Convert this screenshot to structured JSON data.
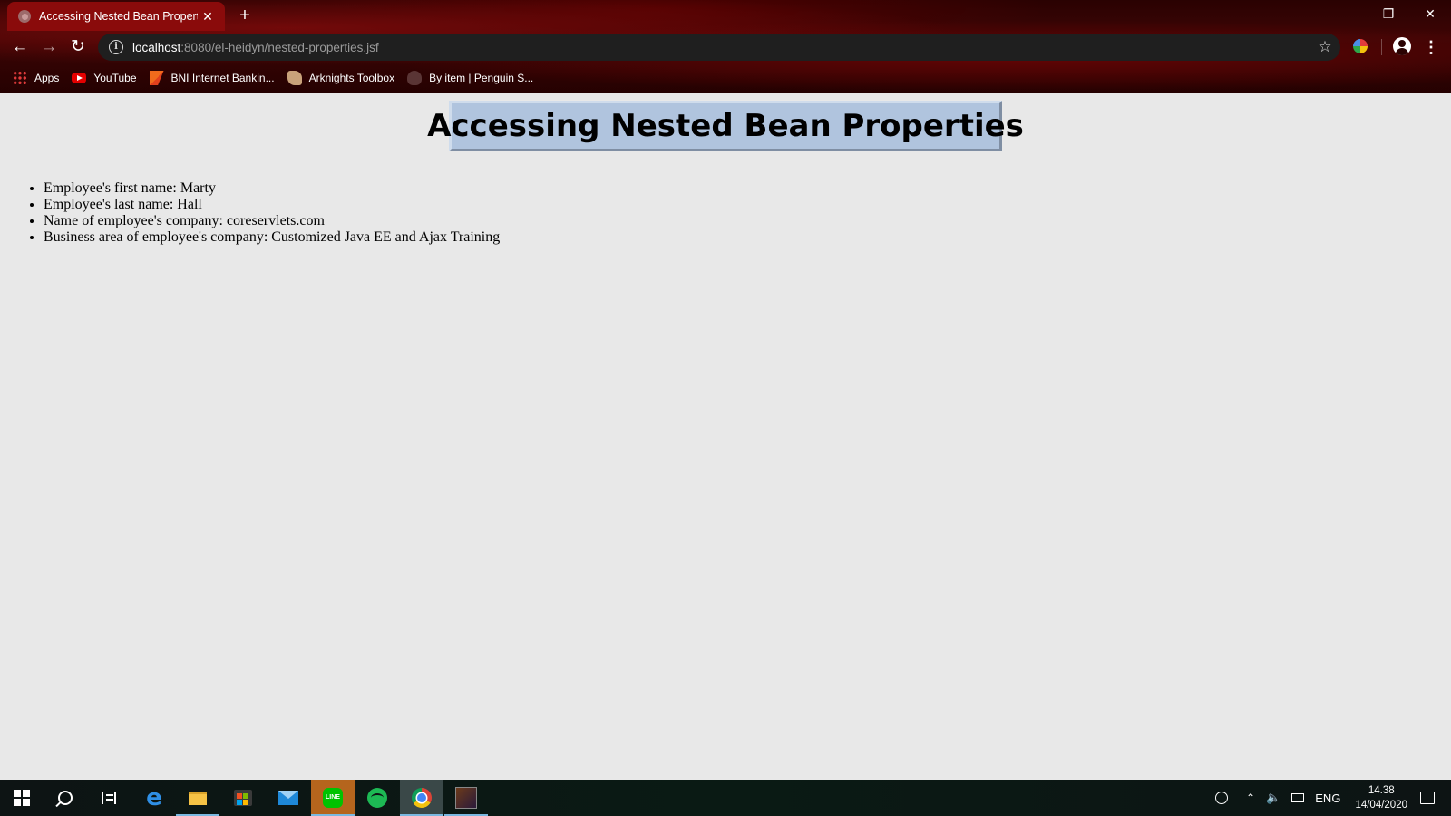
{
  "browser": {
    "tab_title": "Accessing Nested Bean Properties",
    "new_tab_symbol": "+",
    "window_controls": {
      "minimize": "—",
      "restore": "❐",
      "close": "✕"
    },
    "url_host": "localhost",
    "url_rest": ":8080/el-heidyn/nested-properties.jsf",
    "bookmarks": [
      {
        "label": "Apps",
        "icon": "apps-grid-icon"
      },
      {
        "label": "YouTube",
        "icon": "youtube-icon"
      },
      {
        "label": "BNI Internet Bankin...",
        "icon": "bni-icon"
      },
      {
        "label": "Arknights Toolbox",
        "icon": "arknights-icon"
      },
      {
        "label": "By item | Penguin S...",
        "icon": "penguin-icon"
      }
    ],
    "theme_color": "#8a0b0b"
  },
  "page": {
    "heading": "Accessing Nested Bean Properties",
    "heading_bg": "#b0c4de",
    "items": [
      "Employee's first name: Marty",
      "Employee's last name: Hall",
      "Name of employee's company: coreservlets.com",
      "Business area of employee's company: Customized Java EE and Ajax Training"
    ]
  },
  "taskbar": {
    "apps": [
      "start-icon",
      "search-icon",
      "task-view-icon",
      "edge-icon",
      "file-explorer-icon",
      "store-icon",
      "mail-icon",
      "line-icon",
      "spotify-icon",
      "chrome-icon",
      "game-icon"
    ],
    "language": "ENG",
    "time": "14.38",
    "date": "14/04/2020"
  }
}
